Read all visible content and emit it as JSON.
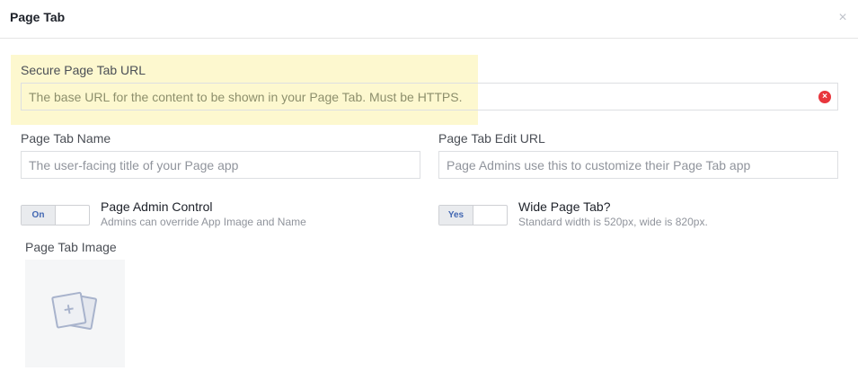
{
  "dialog": {
    "title": "Page Tab",
    "close_glyph": "×"
  },
  "secure_url": {
    "label": "Secure Page Tab URL",
    "placeholder": "The base URL for the content to be shown in your Page Tab. Must be HTTPS.",
    "error_glyph": "×"
  },
  "tab_name": {
    "label": "Page Tab Name",
    "placeholder": "The user-facing title of your Page app"
  },
  "edit_url": {
    "label": "Page Tab Edit URL",
    "placeholder": "Page Admins use this to customize their Page Tab app"
  },
  "admin_control": {
    "toggle_label": "On",
    "title": "Page Admin Control",
    "subtitle": "Admins can override App Image and Name"
  },
  "wide_tab": {
    "toggle_label": "Yes",
    "title": "Wide Page Tab?",
    "subtitle": "Standard width is 520px, wide is 820px."
  },
  "tab_image": {
    "label": "Page Tab Image"
  },
  "colors": {
    "highlight": "#fdf8cf",
    "error": "#e8363d",
    "toggle_text": "#4267b2"
  },
  "icons": [
    "close-icon",
    "error-icon",
    "image-upload-icon"
  ]
}
